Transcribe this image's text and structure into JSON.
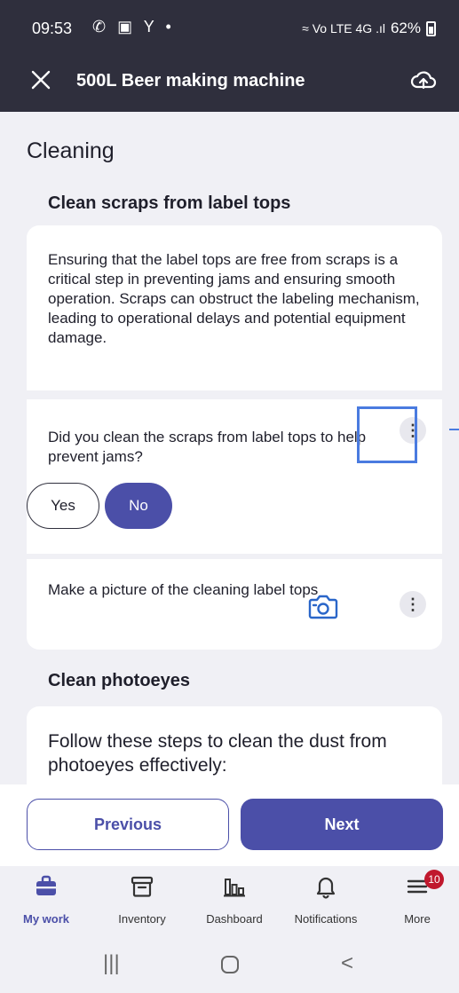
{
  "status_bar": {
    "time": "09:53",
    "icons": "✆ ▣ Y •",
    "battery": "62%",
    "signal": "≈ Vo LTE 4G .ıl"
  },
  "app_bar": {
    "title": "500L Beer making machine"
  },
  "content": {
    "section_title": "Cleaning",
    "task1": {
      "title": "Clean scraps from label tops",
      "description": "Ensuring that the label tops are free from scraps is a critical step in preventing jams and ensuring smooth operation. Scraps can obstruct the labeling mechanism, leading to operational delays and potential equipment damage.",
      "question": "Did you clean the scraps from label tops to help prevent jams?",
      "yes_label": "Yes",
      "no_label": "No",
      "selected": "No",
      "photo_prompt": "Make a picture of the cleaning label tops"
    },
    "task2": {
      "title": "Clean photoeyes",
      "description": "Follow these steps to clean the dust from photoeyes effectively:"
    }
  },
  "buttons": {
    "previous": "Previous",
    "next": "Next"
  },
  "bottom_nav": {
    "items": [
      {
        "label": "My work",
        "icon": "briefcase-icon",
        "active": true
      },
      {
        "label": "Inventory",
        "icon": "archive-box-icon"
      },
      {
        "label": "Dashboard",
        "icon": "bar-chart-icon"
      },
      {
        "label": "Notifications",
        "icon": "bell-icon"
      },
      {
        "label": "More",
        "icon": "menu-lines-icon",
        "badge": "10"
      }
    ]
  },
  "colors": {
    "header": "#2f2f3d",
    "accent": "#4b4fa8",
    "badge": "#c0182d",
    "highlight": "#4a7be0"
  }
}
